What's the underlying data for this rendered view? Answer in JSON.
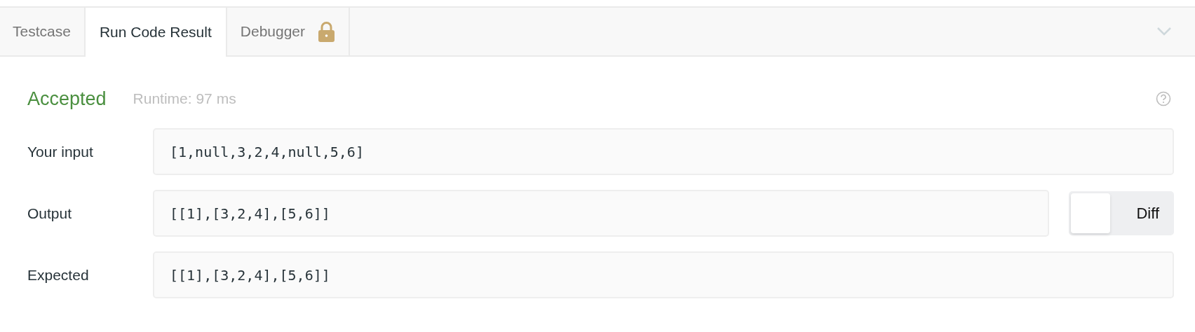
{
  "tabs": [
    {
      "label": "Testcase",
      "selected": false,
      "locked": false
    },
    {
      "label": "Run Code Result",
      "selected": true,
      "locked": false
    },
    {
      "label": "Debugger",
      "selected": false,
      "locked": true
    }
  ],
  "result": {
    "status": "Accepted",
    "runtime": "Runtime: 97 ms"
  },
  "rows": [
    {
      "label": "Your input",
      "value": "[1,null,3,2,4,null,5,6]"
    },
    {
      "label": "Output",
      "value": "[[1],[3,2,4],[5,6]]",
      "diff_toggle": {
        "label": "Diff",
        "on": false
      }
    },
    {
      "label": "Expected",
      "value": "[[1],[3,2,4],[5,6]]"
    }
  ]
}
